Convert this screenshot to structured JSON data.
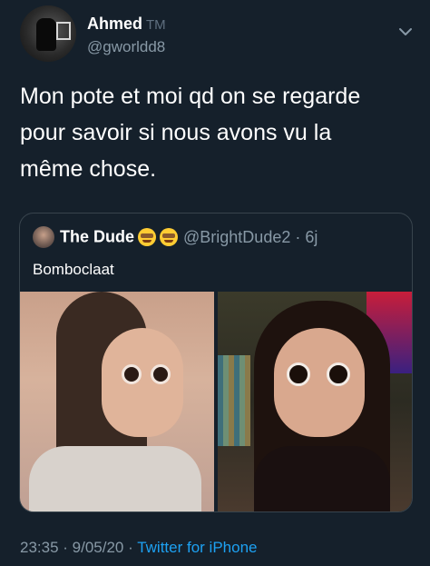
{
  "author": {
    "name": "Ahmed",
    "badge": "TM",
    "handle": "@gworldd8"
  },
  "tweet": {
    "text_lines": [
      "Mon pote et moi qd on se regarde",
      "pour savoir si nous avons vu la",
      "même chose."
    ]
  },
  "quoted_tweet": {
    "name": "The Dude",
    "handle_time": "@BrightDude2 · 6j",
    "text": "Bomboclaat",
    "emoji_icons": [
      "star-struck-emoji-icon",
      "star-struck-emoji-icon"
    ]
  },
  "meta": {
    "time": "23:35",
    "separator": " · ",
    "date": "9/05/20",
    "source": "Twitter for iPhone"
  },
  "icons": {
    "menu": "chevron-down-icon"
  },
  "colors": {
    "background": "#15202b",
    "secondary_text": "#8899a6",
    "link": "#1da1f2",
    "border": "#38444d"
  }
}
